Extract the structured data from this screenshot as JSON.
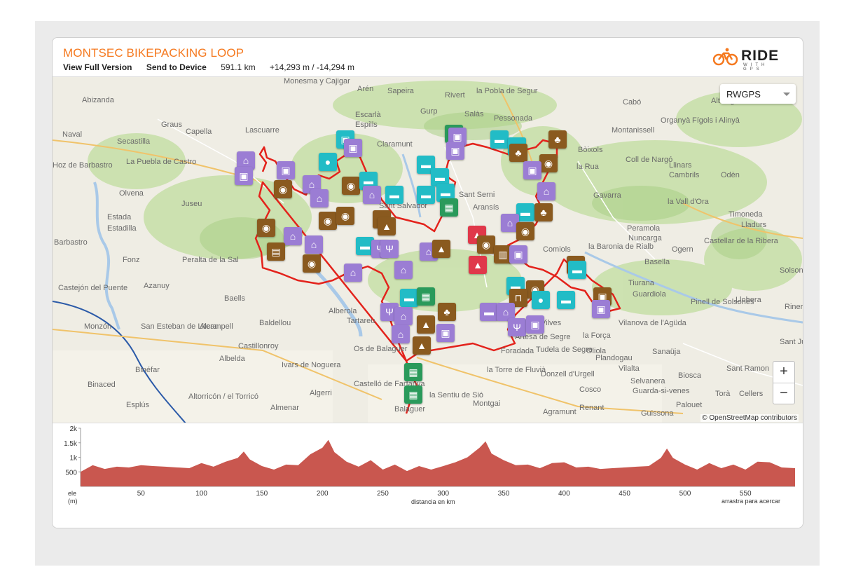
{
  "header": {
    "title": "MONTSEC BIKEPACKING LOOP",
    "view_full_label": "View Full Version",
    "send_to_device_label": "Send to Device",
    "distance": "591.1 km",
    "elevation_gain_loss": "+14,293 m / -14,294 m",
    "logo_text": "RIDE",
    "logo_sub": "WITH GPS"
  },
  "map": {
    "layer_select": "RWGPS",
    "zoom_in": "+",
    "zoom_out": "−",
    "attribution": "© OpenStreetMap contributors",
    "places": [
      "Abizanda",
      "Naval",
      "Graus",
      "Capella",
      "Lascuarre",
      "Secastilla",
      "La Puebla de Castro",
      "Hoz de Barbastro",
      "Olvena",
      "Juseu",
      "Estada",
      "Estadilla",
      "Barbastro",
      "Fonz",
      "Peralta de la Sal",
      "Azanuy",
      "Castejón del Puente",
      "Monzón",
      "San Esteban de Litera",
      "Alcampell",
      "Binaced",
      "Binéfar",
      "Esplús",
      "Altorricón / el Torricó",
      "Albelda",
      "Castillonroy",
      "Baells",
      "Baldellou",
      "Alberola",
      "Tartareu",
      "Os de Balaguer",
      "Castelló de Farfanya",
      "Algerri",
      "Almenar",
      "Ivars de Noguera",
      "Balaguer",
      "la Sentiu de Sió",
      "Montgai",
      "Agramunt",
      "Tudela de Segre",
      "la Torre de Fluvià",
      "Donzell d'Urgell",
      "Cosco",
      "Renant",
      "Oliola",
      "Vilalta",
      "Selvanera",
      "Guarda-si-venes",
      "Guissona",
      "Palouet",
      "Biosca",
      "Sanaüja",
      "Sant Ramon",
      "Cellers",
      "Torà",
      "Sant Just",
      "Solsona",
      "Llobera",
      "Riner",
      "Pinell de Solsonès",
      "Vilanova de l'Agüda",
      "Tiurana",
      "Basella",
      "Ogern",
      "Castellar de la Ribera",
      "Lladurs",
      "Timoneda",
      "la Vall d'Ora",
      "Peramola",
      "Nuncarga",
      "la Baronia de Rialb",
      "Comiols",
      "Gavarra",
      "Coll de Nargó",
      "Fígols i Alinyà",
      "Cabó",
      "Organyà",
      "Montanissell",
      "Bòixols",
      "la Rua",
      "Llinars",
      "Cambrils",
      "Odèn",
      "Pessonada",
      "la Pobla de Segur",
      "Salàs",
      "Gurp",
      "Rivert",
      "Sapeira",
      "Arén",
      "Monesma y Cajigar",
      "Escarlà",
      "Espills",
      "Claramunt",
      "Aransís",
      "Sant Serni",
      "Sant Salvador",
      "Foradada",
      "Vilves",
      "Artesa de Segre",
      "la Força",
      "Plandogau",
      "Alt Urgell",
      "Guardiola",
      "Sant Ramon Biosca"
    ]
  },
  "elevation": {
    "y_ticks": [
      "2k",
      "1.5k",
      "1k",
      "500"
    ],
    "x_ticks": [
      "50",
      "100",
      "150",
      "200",
      "250",
      "300",
      "350",
      "400",
      "450",
      "500",
      "550"
    ],
    "y_unit_label": "ele",
    "y_unit": "(m)",
    "x_label": "distancia en km",
    "hint": "arrastra para acercar",
    "fill_color": "#c9574f"
  },
  "chart_data": {
    "type": "area",
    "title": "",
    "xlabel": "distancia en km",
    "ylabel": "ele (m)",
    "xlim": [
      0,
      591
    ],
    "ylim": [
      0,
      2000
    ],
    "x": [
      0,
      10,
      20,
      30,
      40,
      50,
      60,
      70,
      80,
      90,
      100,
      110,
      120,
      130,
      135,
      140,
      150,
      160,
      170,
      180,
      190,
      200,
      205,
      210,
      220,
      230,
      240,
      250,
      260,
      270,
      280,
      290,
      300,
      310,
      320,
      330,
      335,
      340,
      350,
      360,
      370,
      380,
      390,
      400,
      410,
      420,
      430,
      440,
      450,
      460,
      470,
      480,
      485,
      490,
      500,
      510,
      520,
      530,
      540,
      550,
      560,
      570,
      580,
      591
    ],
    "y": [
      500,
      800,
      600,
      750,
      650,
      800,
      700,
      750,
      650,
      700,
      800,
      750,
      850,
      1050,
      1200,
      1000,
      700,
      650,
      750,
      800,
      1100,
      1400,
      1600,
      1250,
      850,
      750,
      900,
      650,
      750,
      600,
      700,
      650,
      700,
      900,
      1000,
      1400,
      1550,
      1200,
      900,
      800,
      750,
      700,
      800,
      900,
      650,
      750,
      600,
      700,
      650,
      750,
      700,
      1050,
      1300,
      1050,
      750,
      650,
      800,
      700,
      750,
      650,
      850,
      900,
      650,
      700
    ]
  }
}
